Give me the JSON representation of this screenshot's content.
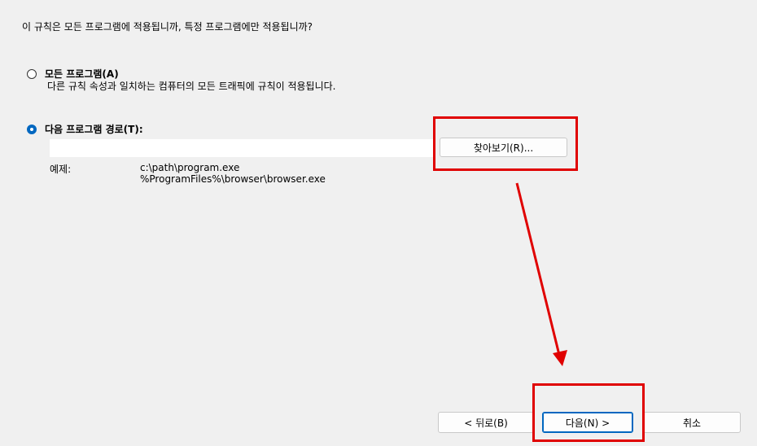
{
  "question": "이 규칙은 모든 프로그램에 적용됩니까, 특정 프로그램에만 적용됩니까?",
  "options": {
    "all_programs": {
      "label": "모든 프로그램(A)",
      "description": "다른 규칙 속성과 일치하는 컴퓨터의 모든 트래픽에 규칙이 적용됩니다.",
      "checked": false
    },
    "program_path": {
      "label": "다음 프로그램 경로(T):",
      "checked": true,
      "value": "",
      "browse_label": "찾아보기(R)..."
    }
  },
  "example": {
    "label": "예제:",
    "line1": "c:\\path\\program.exe",
    "line2": "%ProgramFiles%\\browser\\browser.exe"
  },
  "footer": {
    "back_label": "< 뒤로(B)",
    "next_label": "다음(N) >",
    "cancel_label": "취소"
  },
  "colors": {
    "highlight": "#e00000",
    "accent": "#0067c0",
    "background": "#f0f0f0"
  }
}
